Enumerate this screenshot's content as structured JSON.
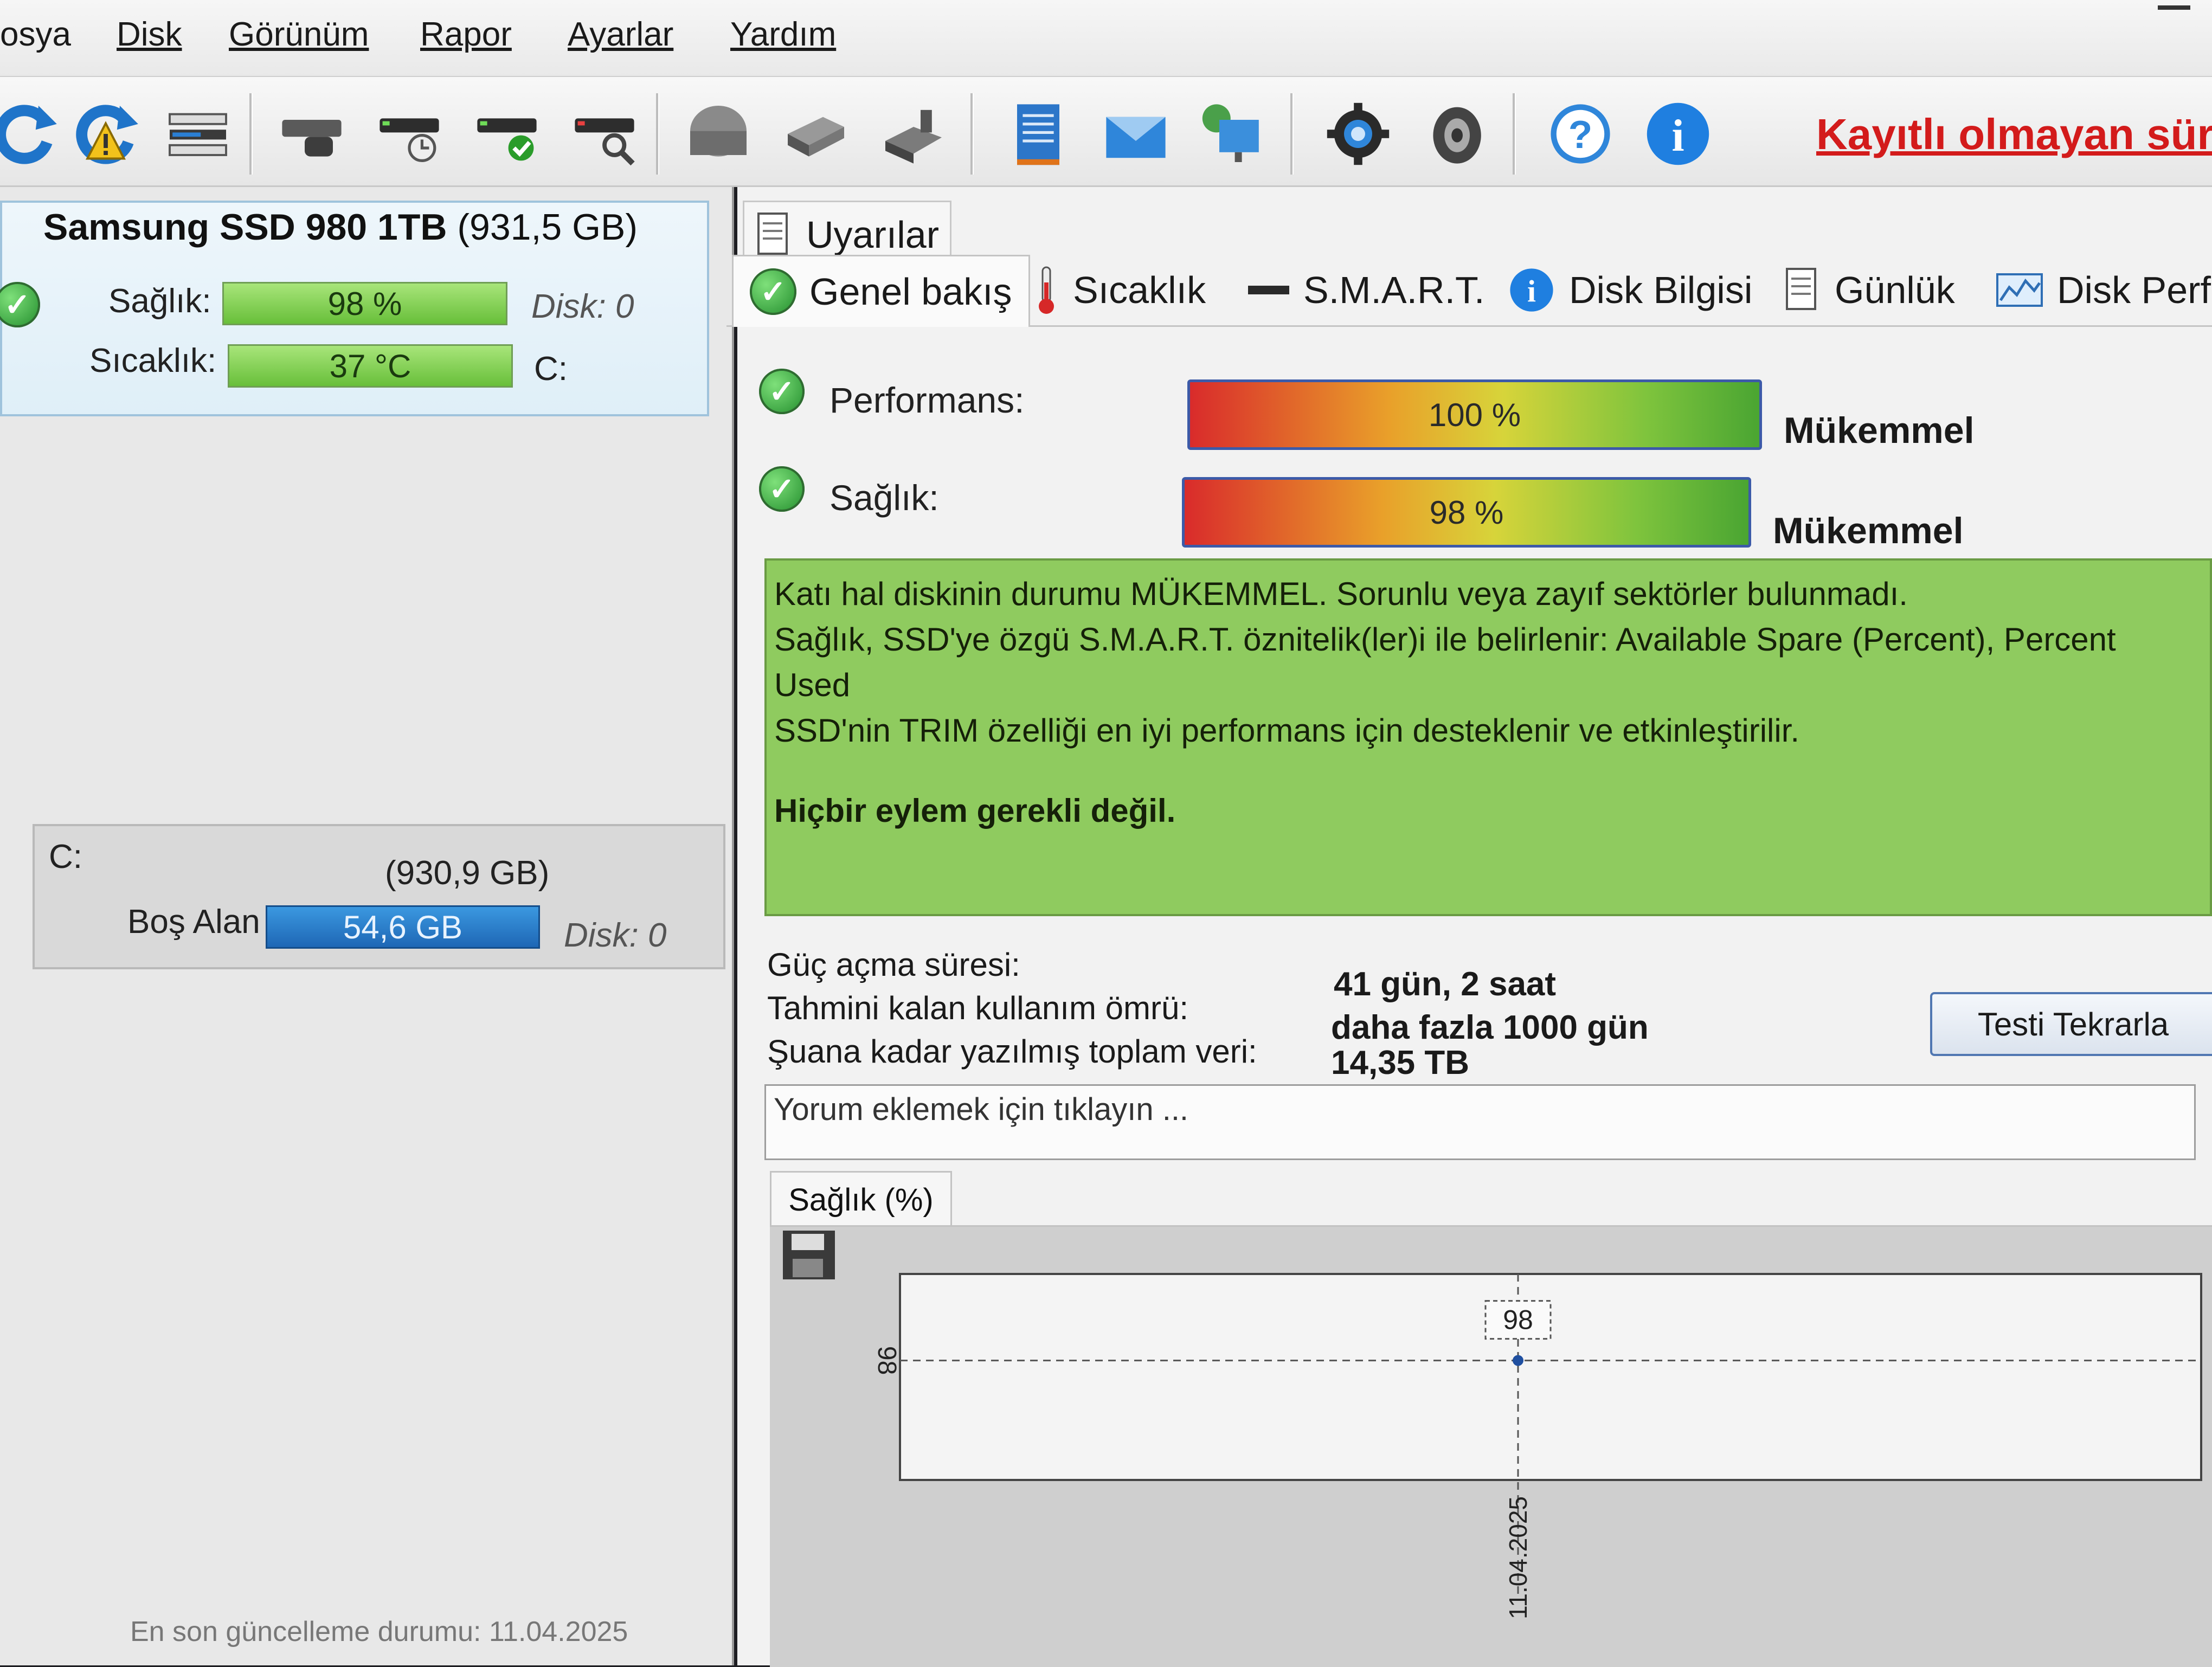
{
  "menu": {
    "items": [
      "osya",
      "Disk",
      "Görünüm",
      "Rapor",
      "Ayarlar",
      "Yardım"
    ]
  },
  "toolbar": {
    "icons": [
      "refresh-icon",
      "refresh-warning-icon",
      "disk-list-icon",
      "disk-icon",
      "disk-schedule-icon",
      "disk-check-icon",
      "disk-search-icon",
      "hdd-icon",
      "usb-drive-icon",
      "external-drive-icon",
      "notes-icon",
      "mail-icon",
      "network-icon",
      "settings-gear-icon",
      "speaker-icon",
      "help-icon",
      "info-icon"
    ],
    "unregistered_text": "Kayıtlı olmayan sürü"
  },
  "left": {
    "disk_name": "Samsung SSD 980 1TB",
    "disk_size": "(931,5 GB)",
    "health_label": "Sağlık:",
    "health_value": "98 %",
    "health_fraction": 0.98,
    "temp_label": "Sıcaklık:",
    "temp_value": "37 °C",
    "disk_index": "Disk: 0",
    "drive_letter": "C:",
    "volume": {
      "letter": "C:",
      "size": "(930,9 GB)",
      "free_label": "Boş Alan",
      "free_value": "54,6 GB",
      "disk_index": "Disk: 0"
    },
    "status_text": "En son güncelleme durumu: 11.04.2025"
  },
  "tabs": {
    "alerts": "Uyarılar",
    "overview": "Genel bakış",
    "temperature": "Sıcaklık",
    "smart": "S.M.A.R.T.",
    "disk_info": "Disk Bilgisi",
    "log": "Günlük",
    "disk_perf": "Disk Perfo"
  },
  "overview": {
    "performance_label": "Performans:",
    "performance_value": "100 %",
    "performance_fraction": 1.0,
    "performance_rating": "Mükemmel",
    "health_label": "Sağlık:",
    "health_value": "98 %",
    "health_fraction": 0.98,
    "health_rating": "Mükemmel",
    "description": {
      "line1": "Katı hal diskinin durumu MÜKEMMEL. Sorunlu veya zayıf sektörler bulunmadı.",
      "line2": "Sağlık, SSD'ye özgü S.M.A.R.T. öznitelik(ler)i ile belirlenir:  Available Spare (Percent), Percent",
      "line3": "Used",
      "line4": "SSD'nin TRIM özelliği en iyi performans için desteklenir ve etkinleştirilir.",
      "action": "Hiçbir eylem gerekli değil."
    },
    "power_on_label": "Güç açma süresi:",
    "power_on_value": "41 gün, 2 saat",
    "life_label": "Tahmini kalan kullanım ömrü:",
    "life_value": "daha fazla 1000 gün",
    "written_label": "Şuana kadar yazılmış toplam veri:",
    "written_value": "14,35 TB",
    "retest_button": "Testi Tekrarla",
    "comment_placeholder": "Yorum eklemek için tıklayın ..."
  },
  "chart_tab": "Sağlık (%)",
  "chart_data": {
    "type": "line",
    "x": [
      "11.04.2025"
    ],
    "series": [
      {
        "values": [
          98
        ]
      }
    ],
    "y_ticks": [
      "98"
    ],
    "data_labels": [
      "98"
    ]
  }
}
